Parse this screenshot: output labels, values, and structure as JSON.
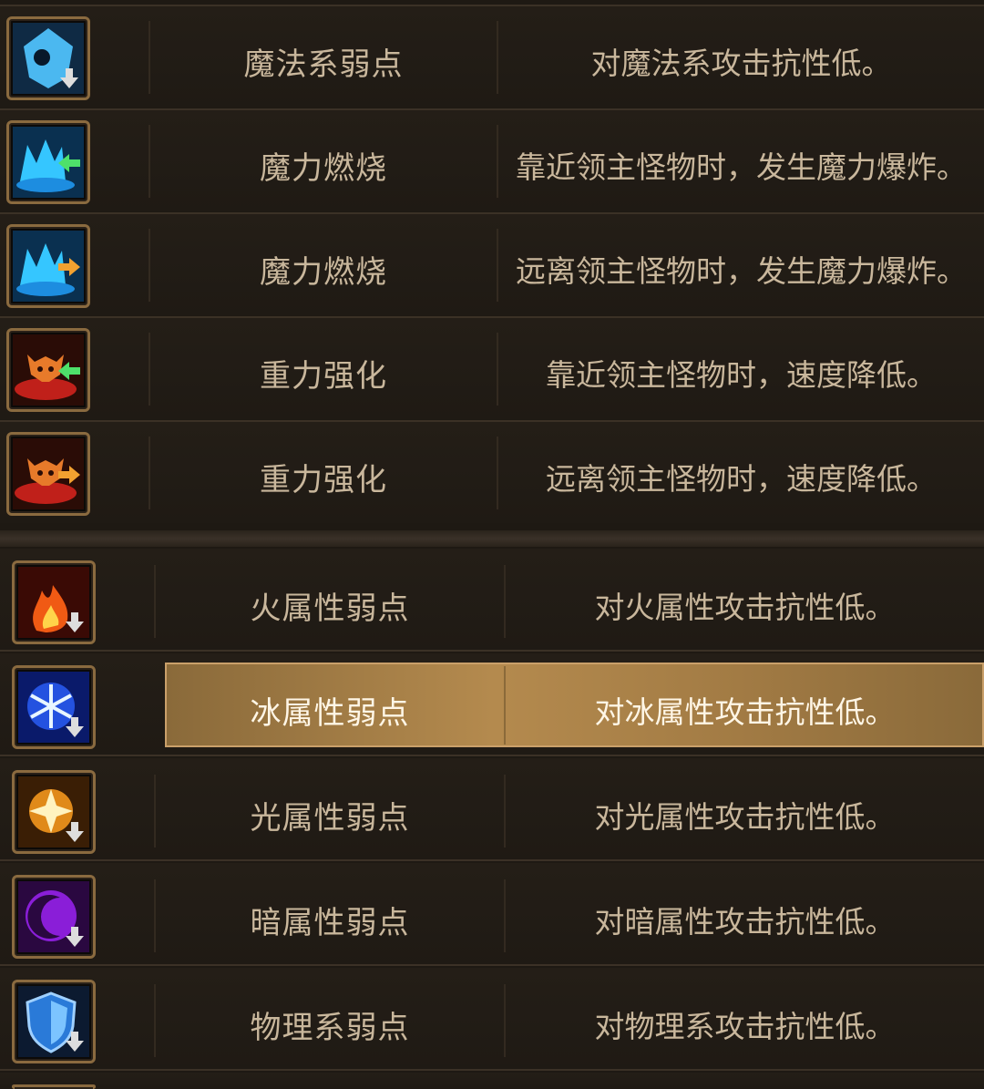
{
  "top_group": [
    {
      "name": "魔法系弱点",
      "desc": "对魔法系攻击抗性低。",
      "icon": "magic-weakness-icon"
    },
    {
      "name": "魔力燃烧",
      "desc": "靠近领主怪物时，发生魔力爆炸。",
      "icon": "mana-burn-near-icon"
    },
    {
      "name": "魔力燃烧",
      "desc": "远离领主怪物时，发生魔力爆炸。",
      "icon": "mana-burn-far-icon"
    },
    {
      "name": "重力强化",
      "desc": "靠近领主怪物时，速度降低。",
      "icon": "gravity-near-icon"
    },
    {
      "name": "重力强化",
      "desc": "远离领主怪物时，速度降低。",
      "icon": "gravity-far-icon"
    }
  ],
  "bottom_group": [
    {
      "name": "火属性弱点",
      "desc": "对火属性攻击抗性低。",
      "icon": "fire-weakness-icon"
    },
    {
      "name": "冰属性弱点",
      "desc": "对冰属性攻击抗性低。",
      "icon": "ice-weakness-icon",
      "selected": true
    },
    {
      "name": "光属性弱点",
      "desc": "对光属性攻击抗性低。",
      "icon": "light-weakness-icon"
    },
    {
      "name": "暗属性弱点",
      "desc": "对暗属性攻击抗性低。",
      "icon": "dark-weakness-icon"
    },
    {
      "name": "物理系弱点",
      "desc": "对物理系攻击抗性低。",
      "icon": "physical-weakness-icon"
    }
  ],
  "colors": {
    "text": "#c9b79c",
    "highlight": "#b48a4e",
    "frame": "#8a6a3f"
  }
}
